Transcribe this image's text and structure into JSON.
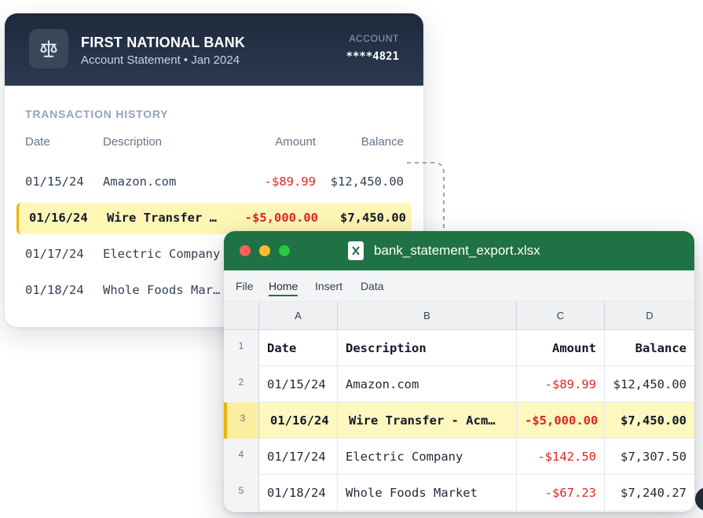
{
  "bank_statement": {
    "bank_name": "FIRST NATIONAL BANK",
    "subtitle": "Account Statement • Jan 2024",
    "account_label": "ACCOUNT",
    "account_number": "****4821",
    "section_title": "TRANSACTION HISTORY",
    "columns": {
      "date": "Date",
      "description": "Description",
      "amount": "Amount",
      "balance": "Balance"
    },
    "rows": [
      {
        "date": "01/15/24",
        "description": "Amazon.com",
        "amount": "-$89.99",
        "balance": "$12,450.00"
      },
      {
        "date": "01/16/24",
        "description": "Wire Transfer …",
        "amount": "-$5,000.00",
        "balance": "$7,450.00"
      },
      {
        "date": "01/17/24",
        "description": "Electric Company",
        "amount": "",
        "balance": ""
      },
      {
        "date": "01/18/24",
        "description": "Whole Foods Mar…",
        "amount": "",
        "balance": ""
      }
    ],
    "highlighted_row_index": 1,
    "icons": {
      "logo": "scales-icon"
    }
  },
  "spreadsheet": {
    "filename": "bank_statement_export.xlsx",
    "menu": [
      "File",
      "Home",
      "Insert",
      "Data"
    ],
    "active_menu": "Home",
    "column_letters": [
      "A",
      "B",
      "C",
      "D"
    ],
    "row_numbers": [
      "1",
      "2",
      "3",
      "4",
      "5"
    ],
    "header": {
      "date": "Date",
      "description": "Description",
      "amount": "Amount",
      "balance": "Balance"
    },
    "rows": [
      {
        "date": "01/15/24",
        "description": "Amazon.com",
        "amount": "-$89.99",
        "balance": "$12,450.00"
      },
      {
        "date": "01/16/24",
        "description": "Wire Transfer - Acm…",
        "amount": "-$5,000.00",
        "balance": "$7,450.00"
      },
      {
        "date": "01/17/24",
        "description": "Electric Company",
        "amount": "-$142.50",
        "balance": "$7,307.50"
      },
      {
        "date": "01/18/24",
        "description": "Whole Foods Market",
        "amount": "-$67.23",
        "balance": "$7,240.27"
      }
    ],
    "selected_row_number": "3",
    "icons": {
      "file": "excel-file-icon"
    }
  },
  "colors": {
    "bank_header": "#1e293b",
    "excel_green": "#1f7244",
    "highlight_yellow": "#fef6b5",
    "highlight_border": "#eab308",
    "negative_red": "#dc2626"
  }
}
